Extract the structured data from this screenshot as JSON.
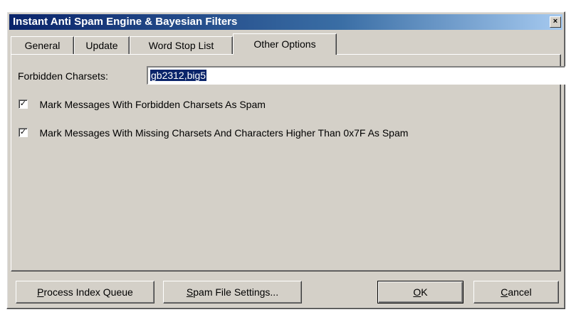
{
  "window": {
    "title": "Instant Anti Spam Engine & Bayesian Filters",
    "close_glyph": "×"
  },
  "tabs": [
    {
      "label": "General"
    },
    {
      "label": "Update"
    },
    {
      "label": "Word Stop List"
    },
    {
      "label": "Other Options",
      "active": true
    }
  ],
  "other_options": {
    "forbidden_charsets_label": "Forbidden Charsets:",
    "forbidden_charsets_value": "gb2312,big5",
    "checkboxes": [
      {
        "label": "Mark Messages With Forbidden Charsets As Spam",
        "checked": true,
        "mark": "✓"
      },
      {
        "label": "Mark Messages With Missing Charsets And Characters Higher Than 0x7F As Spam",
        "checked": true,
        "mark": "✓"
      }
    ]
  },
  "buttons": {
    "process_index_queue": {
      "accel": "P",
      "rest": "rocess Index Queue"
    },
    "spam_file_settings": {
      "accel": "S",
      "rest": "pam File Settings..."
    },
    "ok": {
      "accel": "O",
      "rest": "K"
    },
    "cancel": {
      "accel": "C",
      "rest": "ancel"
    }
  },
  "colors": {
    "titlebar_start": "#0a246a",
    "titlebar_end": "#a6caf0",
    "face": "#d4d0c8",
    "selection": "#0a246a"
  }
}
